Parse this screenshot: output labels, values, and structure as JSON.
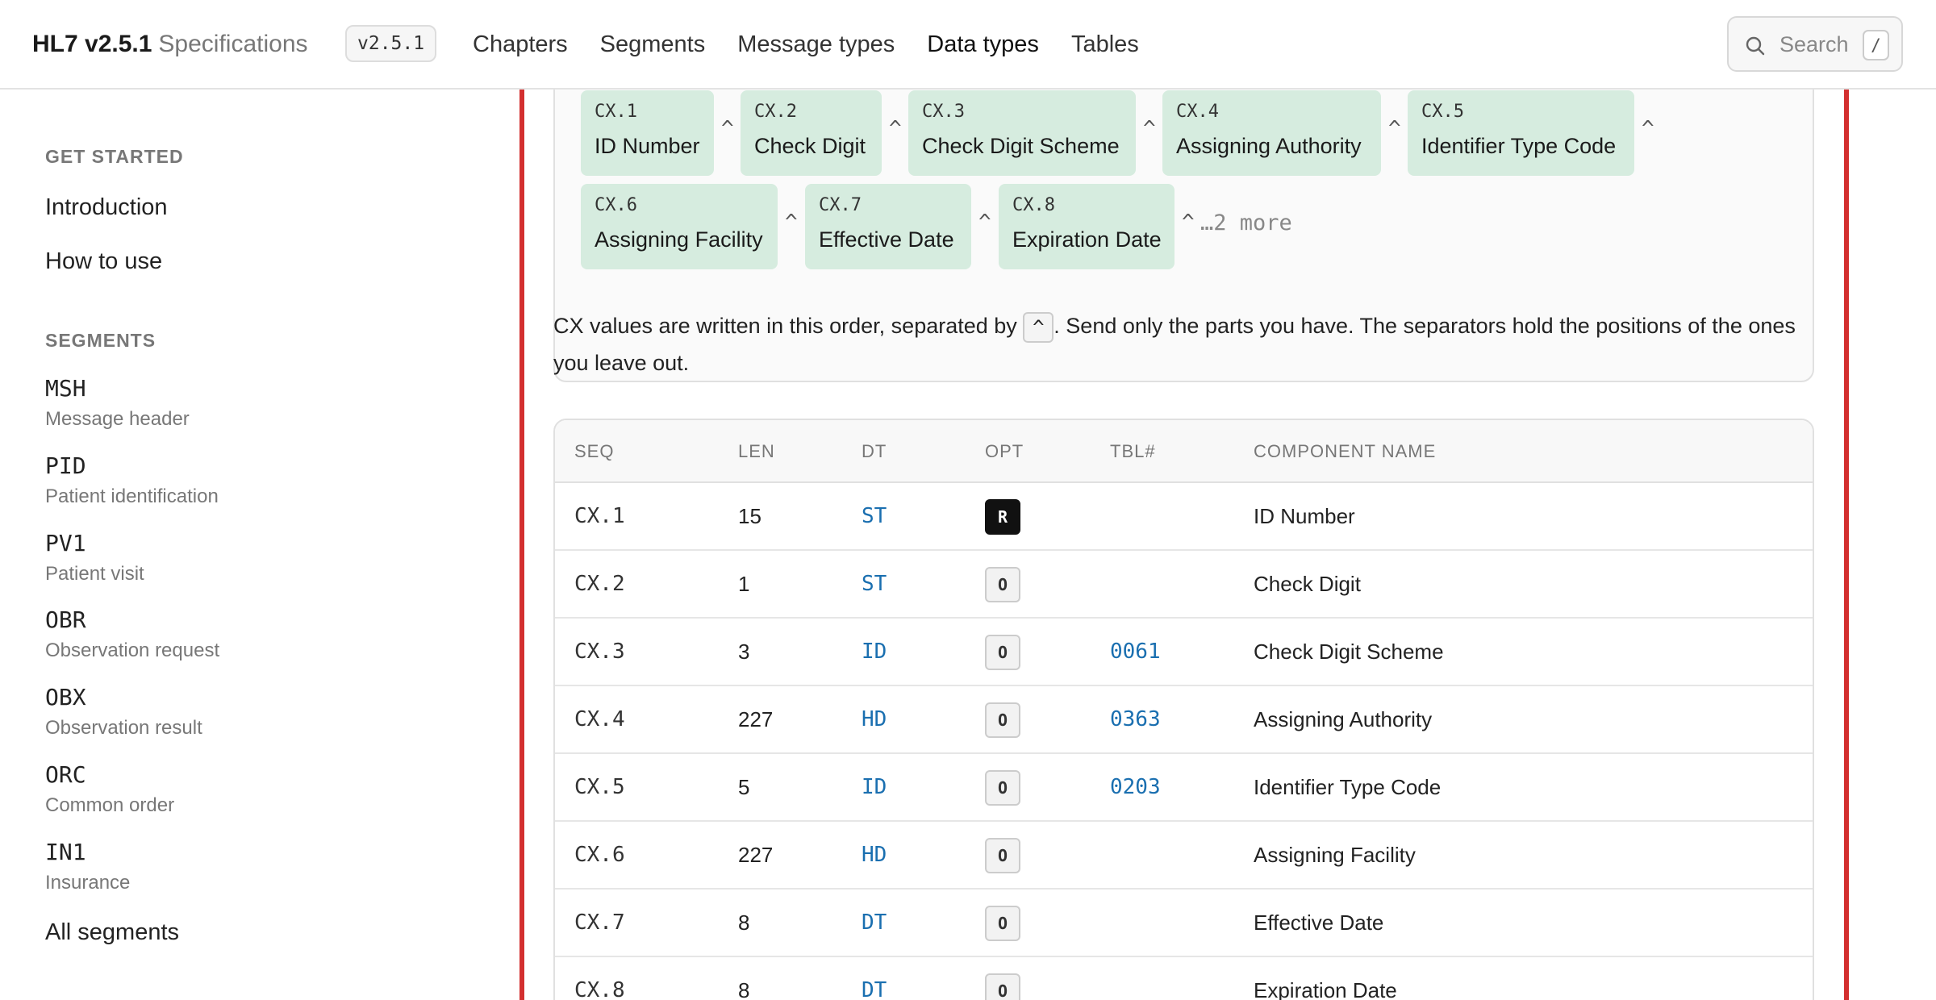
{
  "header": {
    "brand_main": "HL7 v2.5.1",
    "brand_sub": "Specifications",
    "version": "v2.5.1",
    "nav": [
      "Chapters",
      "Segments",
      "Message types",
      "Data types",
      "Tables"
    ],
    "active_nav": "Data types",
    "search_label": "Search",
    "search_shortcut": "/"
  },
  "sidebar": {
    "get_started_heading": "GET STARTED",
    "get_started_links": [
      "Introduction",
      "How to use"
    ],
    "segments_heading": "SEGMENTS",
    "segments": [
      {
        "code": "MSH",
        "desc": "Message header"
      },
      {
        "code": "PID",
        "desc": "Patient identification"
      },
      {
        "code": "PV1",
        "desc": "Patient visit"
      },
      {
        "code": "OBR",
        "desc": "Observation request"
      },
      {
        "code": "OBX",
        "desc": "Observation result"
      },
      {
        "code": "ORC",
        "desc": "Common order"
      },
      {
        "code": "IN1",
        "desc": "Insurance"
      }
    ],
    "all_segments": "All segments"
  },
  "components": {
    "separator": "^",
    "chips": [
      {
        "id": "CX.1",
        "name": "ID Number"
      },
      {
        "id": "CX.2",
        "name": "Check Digit"
      },
      {
        "id": "CX.3",
        "name": "Check Digit Scheme"
      },
      {
        "id": "CX.4",
        "name": "Assigning Authority"
      },
      {
        "id": "CX.5",
        "name": "Identifier Type Code"
      },
      {
        "id": "CX.6",
        "name": "Assigning Facility"
      },
      {
        "id": "CX.7",
        "name": "Effective Date"
      },
      {
        "id": "CX.8",
        "name": "Expiration Date"
      }
    ],
    "more": "…2 more"
  },
  "description": {
    "part1": "CX values are written in this order, separated by ",
    "sep": "^",
    "part2": ". Send only the parts you have. The separators hold the positions of the ones you leave out."
  },
  "table": {
    "headers": [
      "SEQ",
      "LEN",
      "DT",
      "OPT",
      "TBL#",
      "COMPONENT NAME"
    ],
    "rows": [
      {
        "seq": "CX.1",
        "len": "15",
        "dt": "ST",
        "opt": "R",
        "tbl": "",
        "name": "ID Number"
      },
      {
        "seq": "CX.2",
        "len": "1",
        "dt": "ST",
        "opt": "O",
        "tbl": "",
        "name": "Check Digit"
      },
      {
        "seq": "CX.3",
        "len": "3",
        "dt": "ID",
        "opt": "O",
        "tbl": "0061",
        "name": "Check Digit Scheme"
      },
      {
        "seq": "CX.4",
        "len": "227",
        "dt": "HD",
        "opt": "O",
        "tbl": "0363",
        "name": "Assigning Authority"
      },
      {
        "seq": "CX.5",
        "len": "5",
        "dt": "ID",
        "opt": "O",
        "tbl": "0203",
        "name": "Identifier Type Code"
      },
      {
        "seq": "CX.6",
        "len": "227",
        "dt": "HD",
        "opt": "O",
        "tbl": "",
        "name": "Assigning Facility"
      },
      {
        "seq": "CX.7",
        "len": "8",
        "dt": "DT",
        "opt": "O",
        "tbl": "",
        "name": "Effective Date"
      },
      {
        "seq": "CX.8",
        "len": "8",
        "dt": "DT",
        "opt": "O",
        "tbl": "",
        "name": "Expiration Date"
      }
    ]
  },
  "colors": {
    "accent_rail": "#d32f2f",
    "chip_bg": "#d6ecdf",
    "link_blue": "#1a6fb0",
    "required_badge": "#111111"
  }
}
